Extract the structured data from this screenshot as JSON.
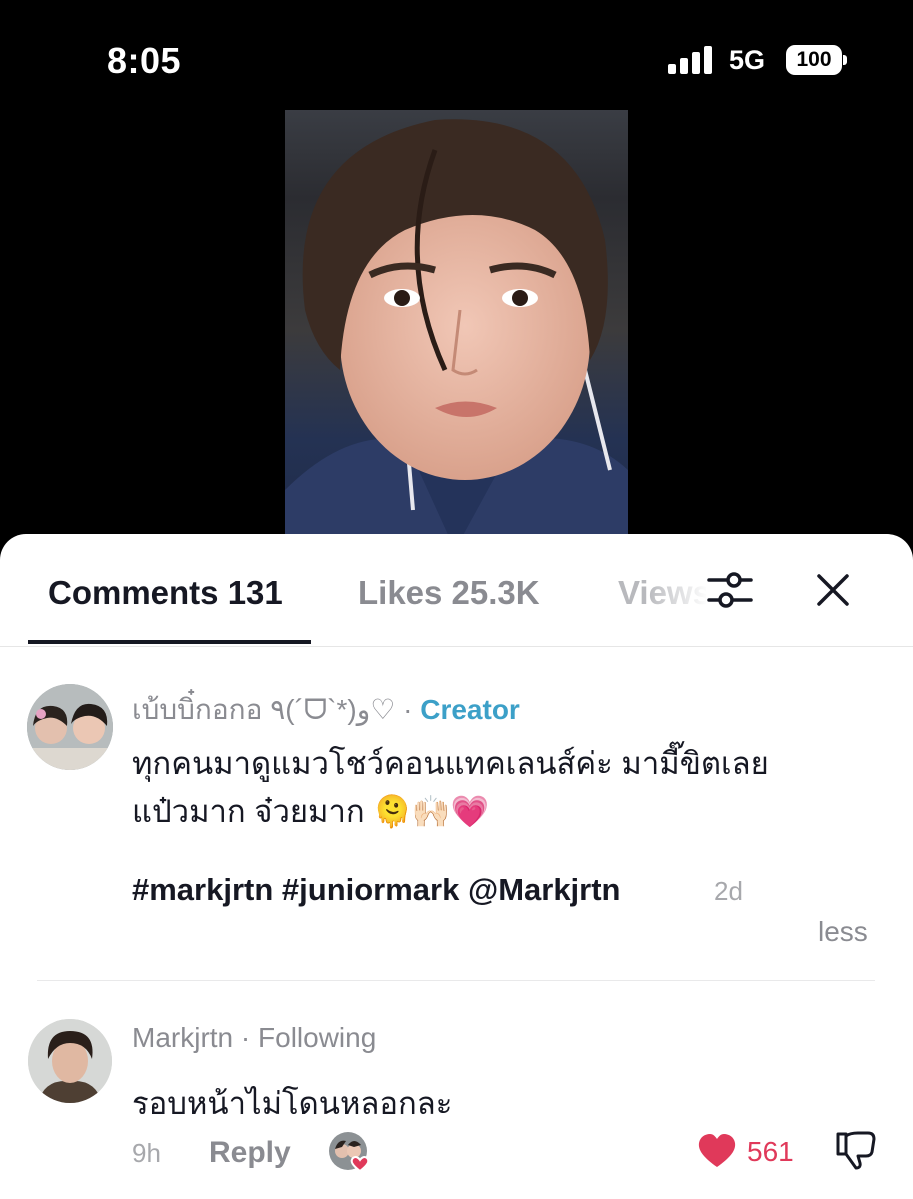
{
  "status_bar": {
    "time": "8:05",
    "network": "5G",
    "battery": "100"
  },
  "tabs": {
    "comments_label": "Comments 131",
    "likes_label": "Likes 25.3K",
    "views_label": "Views"
  },
  "icons": {
    "filter": "filter-sliders-icon",
    "close": "close-icon",
    "like": "heart-icon",
    "dislike": "thumbs-down-icon"
  },
  "colors": {
    "creator_badge": "#3ca0c8",
    "like": "#e0395a",
    "text": "#161823",
    "muted": "#8a8b91"
  },
  "comments": [
    {
      "username": "เบ้บบิ๋กอกอ ٩(´ᗜ`*)و♡",
      "separator": "·",
      "badge": "Creator",
      "line1": "ทุกคนมาดูแมวโชว์คอนแทคเลนส์ค่ะ มามี๊ขิตเลย",
      "line2": "แป๋วมาก จ๋วยมาก 🫠🙌🏻💗",
      "tags": "#markjrtn #juniormark @Markjrtn",
      "time": "2d",
      "less_label": "less"
    },
    {
      "username": "Markjrtn",
      "separator": "·",
      "relation": "Following",
      "text": "รอบหน้าไม่โดนหลอกละ",
      "time": "9h",
      "reply_label": "Reply",
      "likes": "561"
    }
  ]
}
